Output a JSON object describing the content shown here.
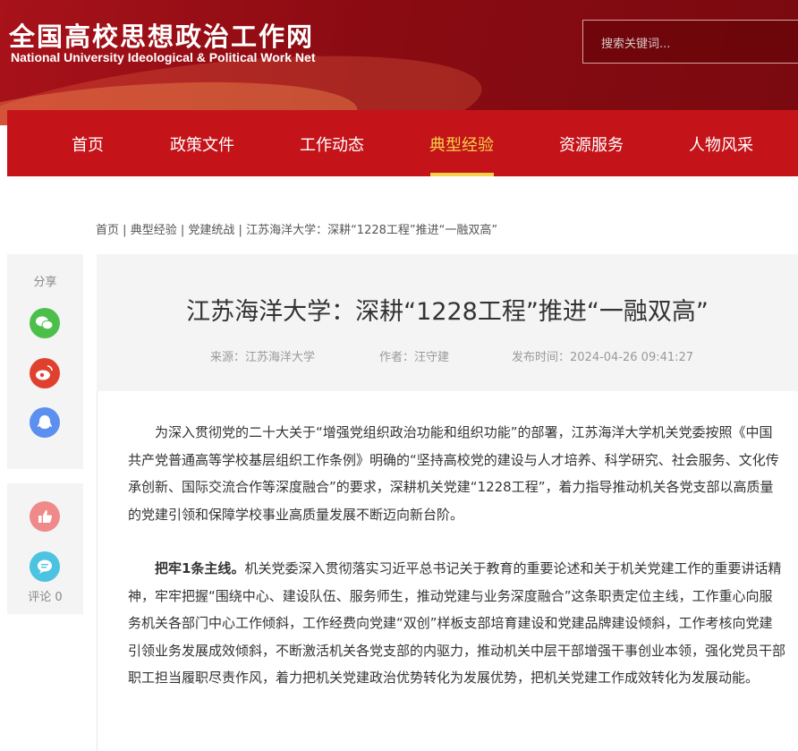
{
  "site": {
    "title_cn": "全国高校思想政治工作网",
    "title_en": "National University Ideological & Political Work Net"
  },
  "search": {
    "placeholder": "搜索关键词..."
  },
  "nav": {
    "items": [
      {
        "label": "首页"
      },
      {
        "label": "政策文件"
      },
      {
        "label": "工作动态"
      },
      {
        "label": "典型经验"
      },
      {
        "label": "资源服务"
      },
      {
        "label": "人物风采"
      }
    ],
    "active": "典型经验"
  },
  "breadcrumb": {
    "items": [
      "首页",
      "典型经验",
      "党建统战",
      "江苏海洋大学：深耕“1228工程”推进“一融双高”"
    ],
    "separator": "|"
  },
  "share": {
    "title": "分享",
    "icons": [
      "wechat-icon",
      "weibo-icon",
      "qq-icon"
    ]
  },
  "interact": {
    "like_icon": "thumbs-up-icon",
    "comment_icon": "comment-icon",
    "comment_label": "评论 0"
  },
  "article": {
    "title": "江苏海洋大学：深耕“1228工程”推进“一融双高”",
    "source": "来源：江苏海洋大学",
    "author": "作者：汪守建",
    "published": "发布时间：2024-04-26 09:41:27",
    "para1": "为深入贯彻党的二十大关于“增强党组织政治功能和组织功能”的部署，江苏海洋大学机关党委按照《中国共产党普通高等学校基层组织工作条例》明确的“坚持高校党的建设与人才培养、科学研究、社会服务、文化传承创新、国际交流合作等深度融合”的要求，深耕机关党建“1228工程”，着力指导推动机关各党支部以高质量的党建引领和保障学校事业高质量发展不断迈向新台阶。",
    "para2_lead": "把牢1条主线。",
    "para2": "机关党委深入贯彻落实习近平总书记关于教育的重要论述和关于机关党建工作的重要讲话精神，牢牢把握“围绕中心、建设队伍、服务师生，推动党建与业务深度融合”这条职责定位主线，工作重心向服务机关各部门中心工作倾斜，工作经费向党建“双创”样板支部培育建设和党建品牌建设倾斜，工作考核向党建引领业务发展成效倾斜，不断激活机关各党支部的内驱力，推动机关中层干部增强干事创业本领，强化党员干部职工担当履职尽责作风，着力把机关党建政治优势转化为发展优势，把机关党建工作成效转化为发展动能。"
  },
  "colors": {
    "brand_red": "#c4141a",
    "active_nav": "#f5d04a"
  }
}
